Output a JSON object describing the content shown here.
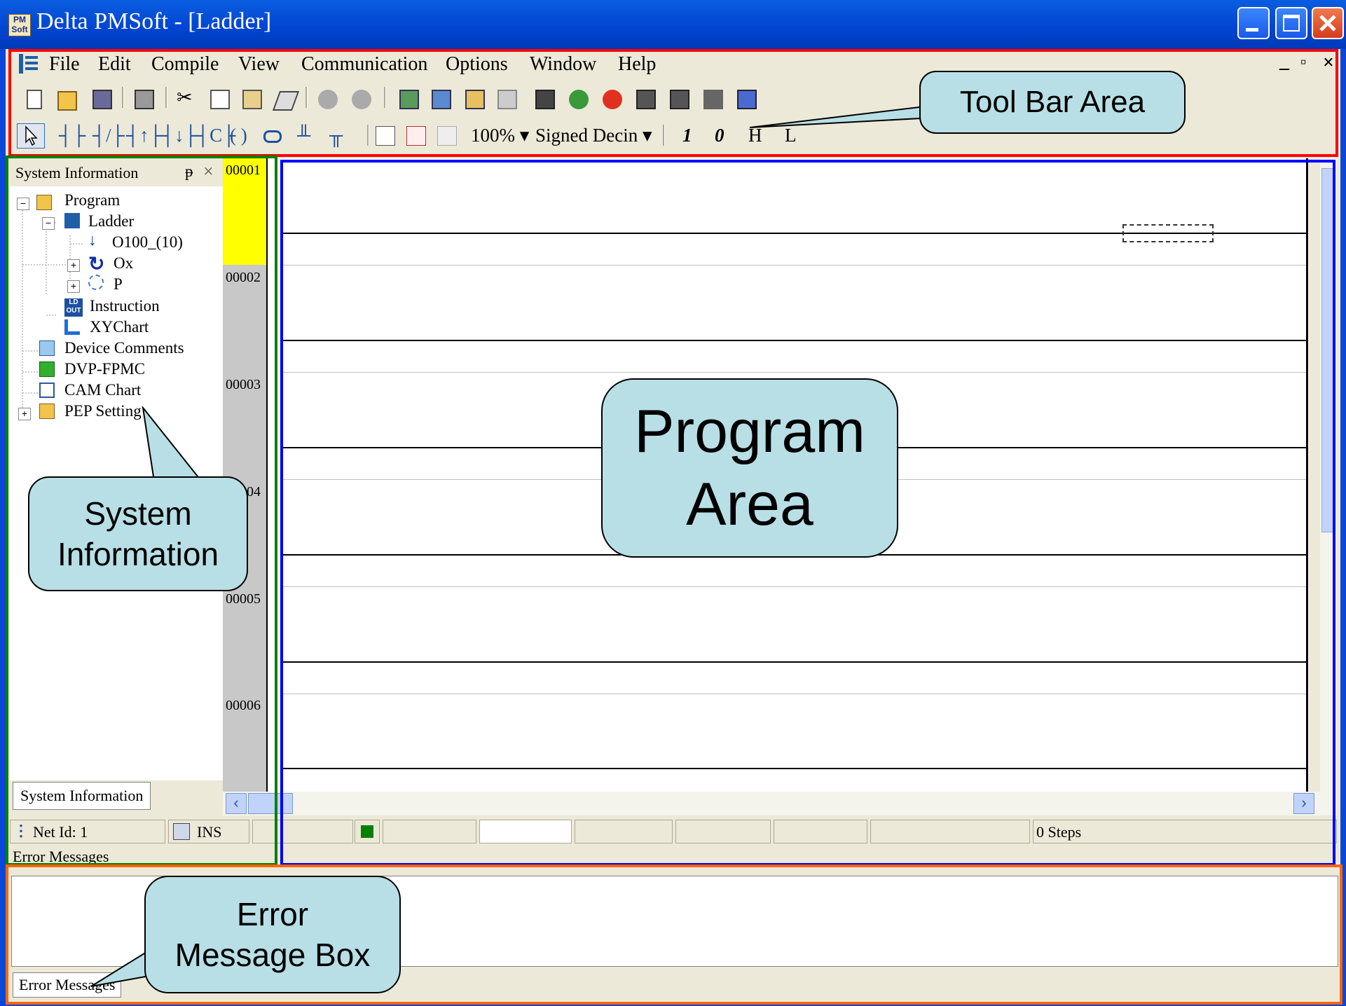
{
  "window": {
    "title": "Delta PMSoft - [Ladder]",
    "app_icon_text": "PM Soft"
  },
  "menu": {
    "items": [
      "File",
      "Edit",
      "Compile",
      "View",
      "Communication",
      "Options",
      "Window",
      "Help"
    ],
    "mdi_controls": [
      "_",
      "▫",
      "×"
    ]
  },
  "toolbar2": {
    "zoom_value": "100%",
    "display_format": "Signed Decin"
  },
  "toolbar2_text_buttons": [
    "1",
    "0",
    "H",
    "L"
  ],
  "sidebar": {
    "title": "System Information",
    "pin": "ᵽ",
    "close": "×",
    "tab_label": "System Information",
    "tree": [
      {
        "label": "Program"
      },
      {
        "label": "Ladder"
      },
      {
        "label": "O100_(10)"
      },
      {
        "label": "Ox"
      },
      {
        "label": "P"
      },
      {
        "label": "Instruction"
      },
      {
        "label": "XYChart"
      },
      {
        "label": "Device Comments"
      },
      {
        "label": "DVP-FPMC"
      },
      {
        "label": "CAM Chart"
      },
      {
        "label": "PEP Setting"
      }
    ]
  },
  "rungs": [
    "00001",
    "00002",
    "00003",
    "00004",
    "00005",
    "00006"
  ],
  "status_bar": {
    "net_id": "Net Id: 1",
    "mode": "INS",
    "steps": "0 Steps"
  },
  "error_panel": {
    "title": "Error Messages",
    "tab_label": "Error Messages"
  },
  "callouts": {
    "toolbar": "Tool Bar Area",
    "system_info": [
      "System",
      "Information"
    ],
    "program": [
      "Program",
      "Area"
    ],
    "error": [
      "Error",
      "Message Box"
    ]
  },
  "colors": {
    "toolbar_highlight": "#ff0000",
    "sidebar_highlight": "#008000",
    "program_highlight": "#0000ff",
    "error_highlight": "#ff6600",
    "callout_fill": "#b8dfe5",
    "active_rung": "#ffff00"
  }
}
